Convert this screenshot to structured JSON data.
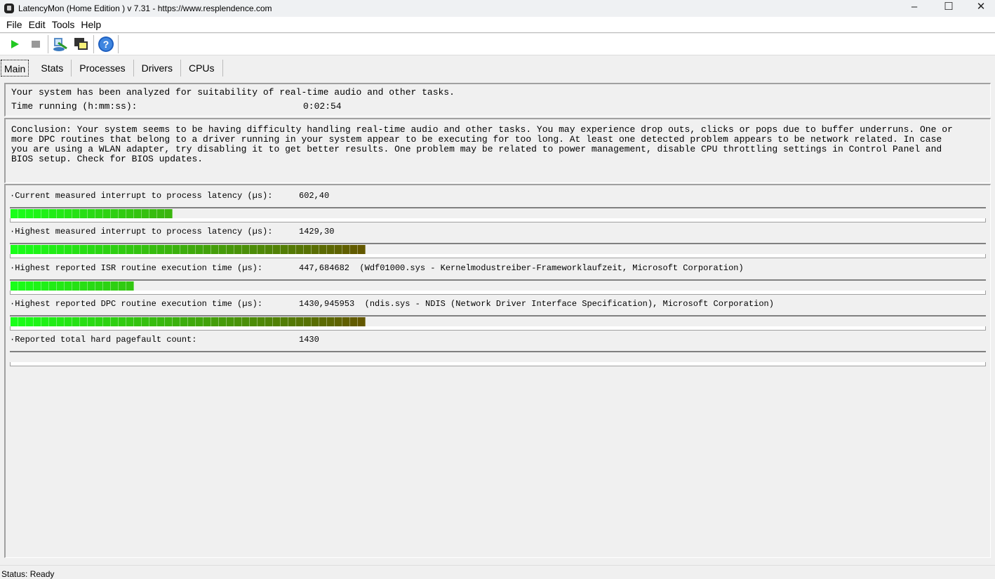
{
  "window": {
    "title": "LatencyMon  (Home Edition )  v 7.31 - https://www.resplendence.com",
    "minimize": "–",
    "maximize": "☐",
    "close": "✕"
  },
  "menu": [
    "File",
    "Edit",
    "Tools",
    "Help"
  ],
  "toolbar": [
    "start-icon",
    "stop-icon",
    "report-icon",
    "windows-icon",
    "help-icon"
  ],
  "tabs": [
    "Main",
    "Stats",
    "Processes",
    "Drivers",
    "CPUs"
  ],
  "summary": {
    "line1": "Your system has been analyzed for suitability of real-time audio and other tasks.",
    "time_label": "Time running (h:mm:ss):",
    "time_value": "0:02:54"
  },
  "conclusion": [
    "Conclusion: Your system seems to be having difficulty handling real-time audio and other tasks. You may experience drop outs, clicks or pops due to buffer underruns. One or",
    "more DPC routines that belong to a driver running in your system appear to be executing for too long. At least one detected problem appears to be network related. In case",
    "you are using a WLAN adapter, try disabling it to get better results. One problem may be related to power management, disable CPU throttling settings in Control Panel and",
    "BIOS setup. Check for BIOS updates."
  ],
  "metrics": [
    {
      "label": "·Current measured interrupt to process latency (µs):",
      "value": "602,40",
      "extra": "",
      "fill": 0.168
    },
    {
      "label": "·Highest measured interrupt to process latency (µs):",
      "value": "1429,30",
      "extra": "",
      "fill": 0.362
    },
    {
      "label": "·Highest reported ISR routine execution time (µs):",
      "value": "447,684682",
      "extra": "  (Wdf01000.sys - Kernelmodustreiber-Frameworklaufzeit, Microsoft Corporation)",
      "fill": 0.129
    },
    {
      "label": "·Highest reported DPC routine execution time (µs):",
      "value": "1430,945953",
      "extra": "  (ndis.sys - NDIS (Network Driver Interface Specification), Microsoft Corporation)",
      "fill": 0.362
    },
    {
      "label": "·Reported total hard pagefault count:",
      "value": "1430",
      "extra": "",
      "fill": 0
    }
  ],
  "status": "Status: Ready"
}
